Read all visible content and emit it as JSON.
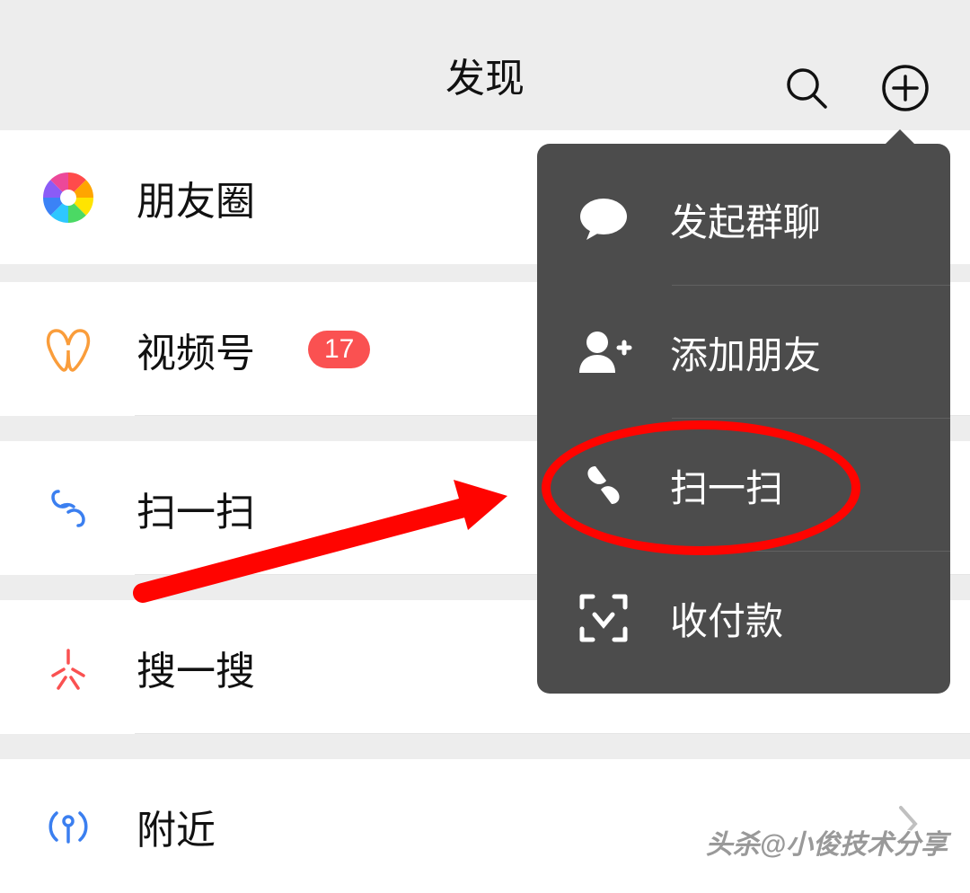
{
  "header": {
    "title": "发现"
  },
  "list": {
    "moments": "朋友圈",
    "channels": "视频号",
    "channels_badge": "17",
    "scan": "扫一扫",
    "search": "搜一搜",
    "nearby": "附近"
  },
  "dropdown": {
    "group_chat": "发起群聊",
    "add_friend": "添加朋友",
    "scan": "扫一扫",
    "payment": "收付款"
  },
  "watermark": "头杀@小俊技术分享"
}
